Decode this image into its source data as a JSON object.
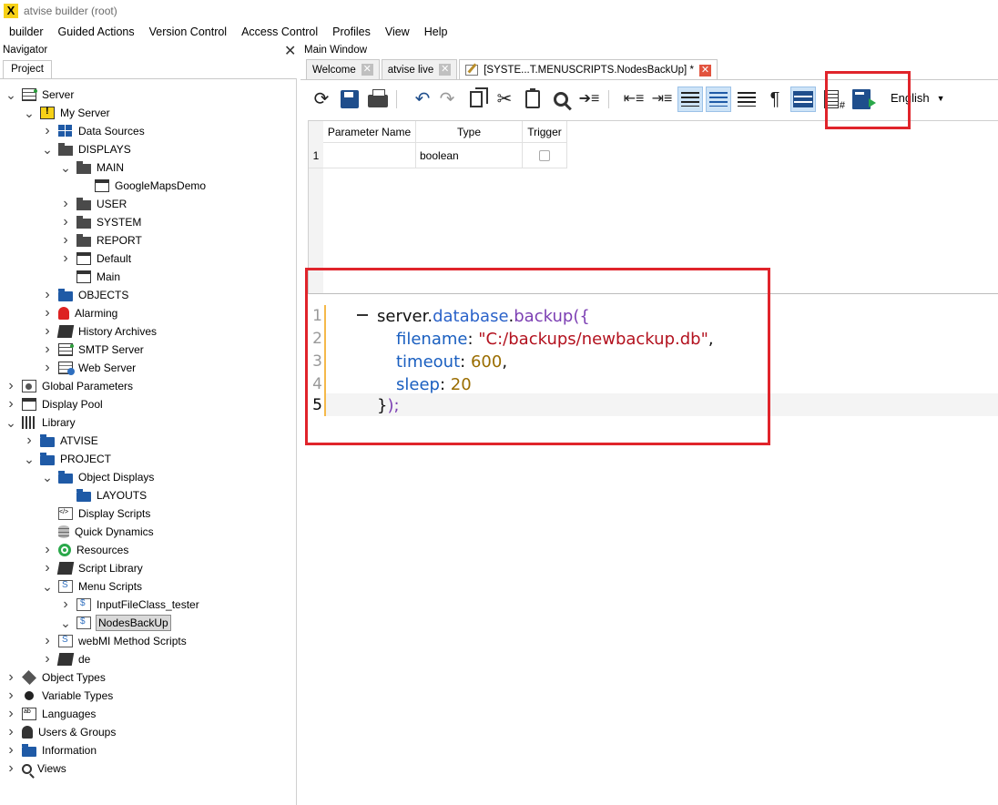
{
  "window": {
    "title": "atvise builder  (root)",
    "logo": "X"
  },
  "menu": [
    "builder",
    "Guided Actions",
    "Version Control",
    "Access Control",
    "Profiles",
    "View",
    "Help"
  ],
  "navigator": {
    "title": "Navigator",
    "close": "✕",
    "tab": "Project",
    "tree": [
      {
        "label": "Server",
        "depth": 0,
        "arrow": "down",
        "icon": "server-icon"
      },
      {
        "label": "My Server",
        "depth": 1,
        "arrow": "down",
        "icon": "my-server-icon"
      },
      {
        "label": "Data Sources",
        "depth": 2,
        "arrow": "right",
        "icon": "data-sources-icon"
      },
      {
        "label": "DISPLAYS",
        "depth": 2,
        "arrow": "down",
        "icon": "folder-dark-icon"
      },
      {
        "label": "MAIN",
        "depth": 3,
        "arrow": "down",
        "icon": "folder-dark-icon"
      },
      {
        "label": "GoogleMapsDemo",
        "depth": 4,
        "arrow": "none",
        "icon": "display-icon"
      },
      {
        "label": "USER",
        "depth": 3,
        "arrow": "right",
        "icon": "folder-dark-icon"
      },
      {
        "label": "SYSTEM",
        "depth": 3,
        "arrow": "right",
        "icon": "folder-dark-icon"
      },
      {
        "label": "REPORT",
        "depth": 3,
        "arrow": "right",
        "icon": "folder-dark-icon"
      },
      {
        "label": "Default",
        "depth": 3,
        "arrow": "right",
        "icon": "display-icon"
      },
      {
        "label": "Main",
        "depth": 3,
        "arrow": "none",
        "icon": "display-icon"
      },
      {
        "label": "OBJECTS",
        "depth": 2,
        "arrow": "right",
        "icon": "folder-icon"
      },
      {
        "label": "Alarming",
        "depth": 2,
        "arrow": "right",
        "icon": "alarm-bell-icon"
      },
      {
        "label": "History Archives",
        "depth": 2,
        "arrow": "right",
        "icon": "history-book-icon"
      },
      {
        "label": "SMTP Server",
        "depth": 2,
        "arrow": "right",
        "icon": "smtp-server-icon"
      },
      {
        "label": "Web Server",
        "depth": 2,
        "arrow": "right",
        "icon": "web-server-icon"
      },
      {
        "label": "Global Parameters",
        "depth": 0,
        "arrow": "right",
        "icon": "parameters-icon"
      },
      {
        "label": "Display Pool",
        "depth": 0,
        "arrow": "right",
        "icon": "display-icon"
      },
      {
        "label": "Library",
        "depth": 0,
        "arrow": "down",
        "icon": "library-icon"
      },
      {
        "label": "ATVISE",
        "depth": 1,
        "arrow": "right",
        "icon": "folder-icon"
      },
      {
        "label": "PROJECT",
        "depth": 1,
        "arrow": "down",
        "icon": "folder-icon"
      },
      {
        "label": "Object Displays",
        "depth": 2,
        "arrow": "down",
        "icon": "folder-icon"
      },
      {
        "label": "LAYOUTS",
        "depth": 3,
        "arrow": "none",
        "icon": "folder-icon"
      },
      {
        "label": "Display Scripts",
        "depth": 2,
        "arrow": "none",
        "icon": "display-script-icon"
      },
      {
        "label": "Quick Dynamics",
        "depth": 2,
        "arrow": "none",
        "icon": "quick-dynamics-icon"
      },
      {
        "label": "Resources",
        "depth": 2,
        "arrow": "right",
        "icon": "resources-icon"
      },
      {
        "label": "Script Library",
        "depth": 2,
        "arrow": "right",
        "icon": "script-library-icon"
      },
      {
        "label": "Menu Scripts",
        "depth": 2,
        "arrow": "down",
        "icon": "menu-scripts-icon"
      },
      {
        "label": "InputFileClass_tester",
        "depth": 3,
        "arrow": "right",
        "icon": "script-file-icon"
      },
      {
        "label": "NodesBackUp",
        "depth": 3,
        "arrow": "down",
        "icon": "script-file-icon",
        "selected": true
      },
      {
        "label": "webMI Method Scripts",
        "depth": 2,
        "arrow": "right",
        "icon": "webmi-script-icon"
      },
      {
        "label": "de",
        "depth": 2,
        "arrow": "right",
        "icon": "language-book-icon"
      },
      {
        "label": "Object Types",
        "depth": 0,
        "arrow": "right",
        "icon": "object-types-icon"
      },
      {
        "label": "Variable Types",
        "depth": 0,
        "arrow": "right",
        "icon": "variable-types-icon"
      },
      {
        "label": "Languages",
        "depth": 0,
        "arrow": "right",
        "icon": "languages-icon"
      },
      {
        "label": "Users & Groups",
        "depth": 0,
        "arrow": "right",
        "icon": "user-icon"
      },
      {
        "label": "Information",
        "depth": 0,
        "arrow": "right",
        "icon": "folder-icon"
      },
      {
        "label": "Views",
        "depth": 0,
        "arrow": "right",
        "icon": "search-icon"
      }
    ]
  },
  "main": {
    "title": "Main Window",
    "tabs": [
      {
        "label": "Welcome",
        "active": false
      },
      {
        "label": "atvise live",
        "active": false
      },
      {
        "label": "[SYSTE...T.MENUSCRIPTS.NodesBackUp] *",
        "active": true
      }
    ],
    "tab_close": "✕",
    "toolbar": {
      "icons": [
        "reload-icon",
        "save-icon",
        "print-icon",
        "undo-icon",
        "redo-icon",
        "copy-icon",
        "cut-icon",
        "paste-icon",
        "find-icon",
        "goto-line-icon",
        "unindent-icon",
        "indent-icon",
        "word-wrap-icon",
        "numbered-list-icon",
        "lines-icon",
        "pilcrow-icon",
        "table-view-icon",
        "line-numbers-icon",
        "run-script-icon"
      ],
      "language": "English"
    },
    "params": {
      "headers": [
        "Parameter Name",
        "Type",
        "Trigger"
      ],
      "rows": [
        {
          "num": "1",
          "name": "",
          "type": "boolean",
          "trigger": false
        }
      ]
    },
    "editor": {
      "line_numbers": [
        "1",
        "2",
        "3",
        "4",
        "5"
      ],
      "current_line": 5
    }
  },
  "colors": {
    "highlight_red": "#e0242b",
    "accent_blue": "#1f5aa6",
    "gutter_orange": "#f5b94a"
  }
}
